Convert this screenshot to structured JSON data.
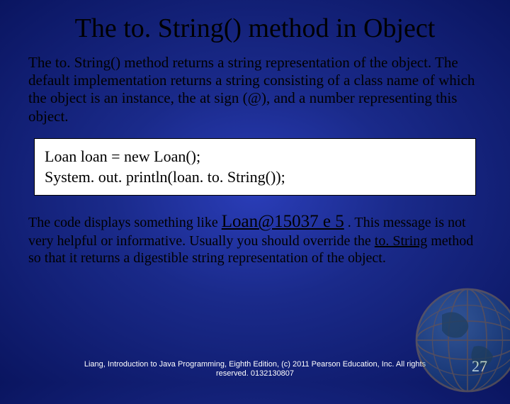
{
  "title": "The to. String() method in Object",
  "para1": "The to. String() method returns a string representation of the object. The default implementation returns a string consisting of a class name of which the object is an instance, the at sign (@), and a number representing this object.",
  "code": {
    "line1": "Loan loan = new Loan();",
    "line2": "System. out. println(loan. to. String());"
  },
  "para2_pre": "The code displays something like ",
  "para2_code": "Loan@15037 e 5",
  "para2_mid": " . This message is not very helpful or informative. Usually you should override the ",
  "para2_u": "to. String",
  "para2_post": " method so that it returns a digestible string representation of the object.",
  "footer": "Liang, Introduction to Java Programming, Eighth Edition, (c) 2011 Pearson Education, Inc. All rights reserved. 0132130807",
  "pagenum": "27"
}
